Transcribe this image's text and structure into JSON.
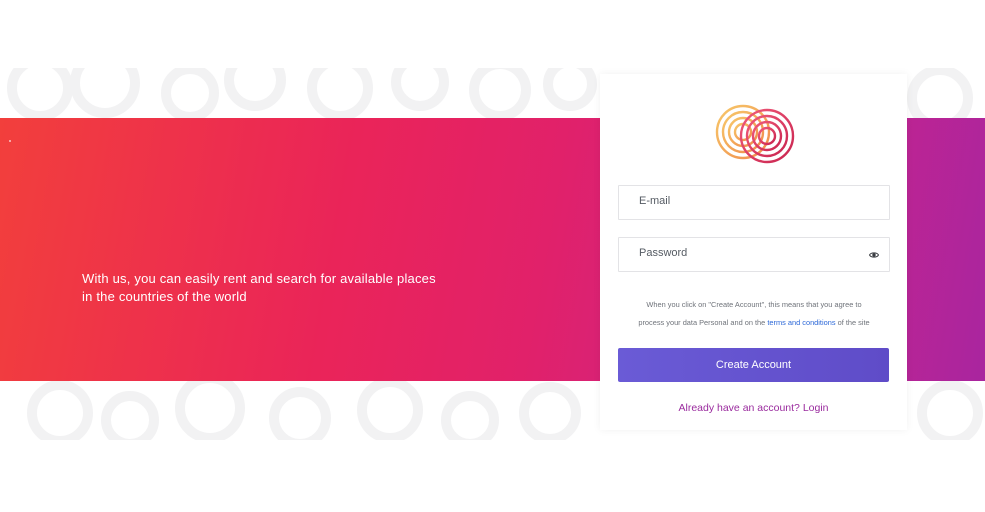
{
  "hero": {
    "tagline_line1": "With us, you can easily rent and search for available places",
    "tagline_line2": "in the countries of the world"
  },
  "form": {
    "email_placeholder": "E-mail",
    "password_placeholder": "Password",
    "terms_prefix": "When you click on \"Create Account\", this means that you agree to",
    "terms_middle": "process your data Personal and on the ",
    "terms_link": "terms and conditions",
    "terms_suffix": " of the site",
    "create_button": "Create Account",
    "login_link": "Already have an account? Login"
  },
  "icons": {
    "logo": "concentric-rings-logo",
    "password_toggle": "eye-icon"
  },
  "colors": {
    "gradient_start": "#f23f3c",
    "gradient_mid": "#e1216a",
    "gradient_end": "#a9259f",
    "button": "#5f4cc8",
    "link": "#2c68d8",
    "login_link": "#9a2b9e"
  }
}
